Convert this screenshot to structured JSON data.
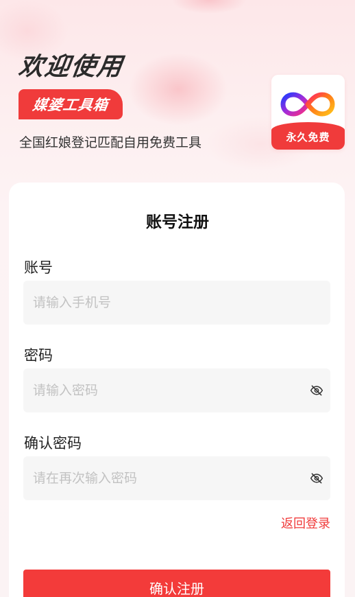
{
  "header": {
    "welcome": "欢迎使用",
    "brand": "媒婆工具箱",
    "subtitle": "全国红娘登记匹配自用免费工具",
    "logo_tag": "永久免费",
    "logo_icon": "infinity-logo-icon"
  },
  "form": {
    "title": "账号注册",
    "account": {
      "label": "账号",
      "value": "",
      "placeholder": "请输入手机号"
    },
    "password": {
      "label": "密码",
      "value": "",
      "placeholder": "请输入密码",
      "toggle_icon": "eye-off-icon"
    },
    "confirm_password": {
      "label": "确认密码",
      "value": "",
      "placeholder": "请在再次输入密码",
      "toggle_icon": "eye-off-icon"
    },
    "back_to_login": "返回登录",
    "submit_label": "确认注册"
  },
  "colors": {
    "accent": "#f03b3b",
    "background": "#fde7e9",
    "input_bg": "#f6f6f6",
    "placeholder": "#c2c2c2"
  }
}
